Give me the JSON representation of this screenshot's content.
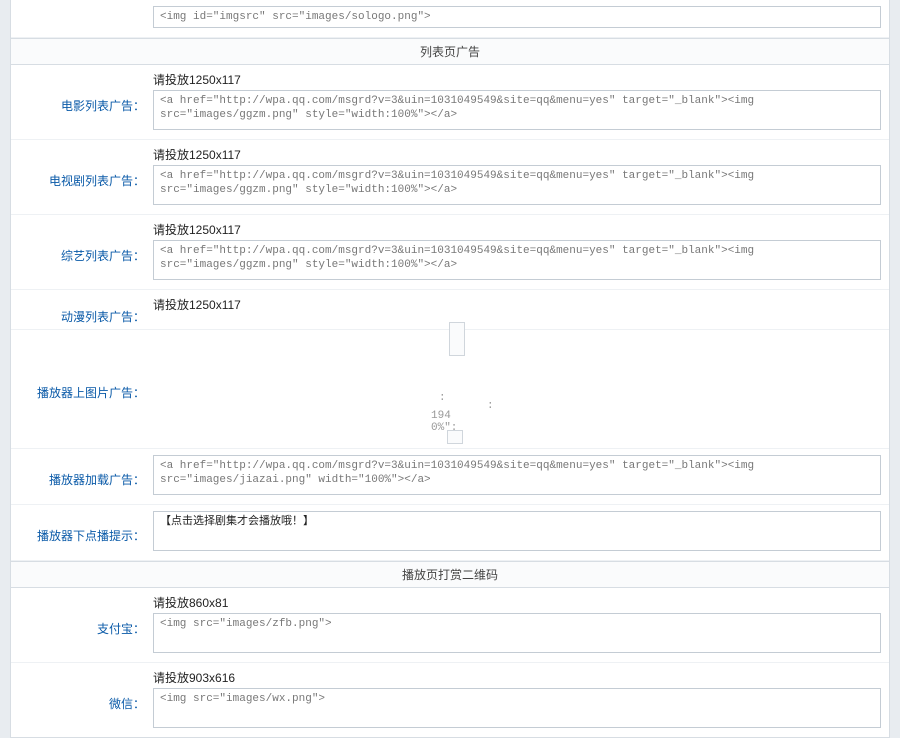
{
  "top_fragment": "<img id=\"imgsrc\" src=\"images/sologo.png\">",
  "headers": {
    "list_ads": "列表页广告",
    "qr_codes": "播放页打赏二维码"
  },
  "rows": {
    "movie_list": {
      "label": "电影列表广告：",
      "hint": "请投放1250x117",
      "value": "<a href=\"http://wpa.qq.com/msgrd?v=3&uin=1031049549&site=qq&menu=yes\" target=\"_blank\"><img src=\"images/ggzm.png\" style=\"width:100%\"></a>"
    },
    "tv_list": {
      "label": "电视剧列表广告：",
      "hint": "请投放1250x117",
      "value": "<a href=\"http://wpa.qq.com/msgrd?v=3&uin=1031049549&site=qq&menu=yes\" target=\"_blank\"><img src=\"images/ggzm.png\" style=\"width:100%\"></a>"
    },
    "variety_list": {
      "label": "综艺列表广告：",
      "hint": "请投放1250x117",
      "value": "<a href=\"http://wpa.qq.com/msgrd?v=3&uin=1031049549&site=qq&menu=yes\" target=\"_blank\"><img src=\"images/ggzm.png\" style=\"width:100%\"></a>"
    },
    "anime_list": {
      "label": "动漫列表广告：",
      "hint": "请投放1250x117"
    },
    "player_top": {
      "label": "播放器上图片广告："
    },
    "player_load": {
      "label": "播放器加载广告：",
      "value": "<a href=\"http://wpa.qq.com/msgrd?v=3&uin=1031049549&site=qq&menu=yes\" target=\"_blank\"><img src=\"images/jiazai.png\" width=\"100%\"></a>"
    },
    "player_tip": {
      "label": "播放器下点播提示：",
      "value": "【点击选择剧集才会播放哦！】"
    },
    "alipay": {
      "label": "支付宝：",
      "hint": "请投放860x81",
      "value": "<img src=\"images/zfb.png\">"
    },
    "wechat": {
      "label": "微信：",
      "hint": "请投放903x616",
      "value": "<img src=\"images/wx.png\">"
    }
  },
  "fragments": {
    "colon1": ":",
    "colon2": ":",
    "num": "194",
    "pct": "0%\":"
  }
}
